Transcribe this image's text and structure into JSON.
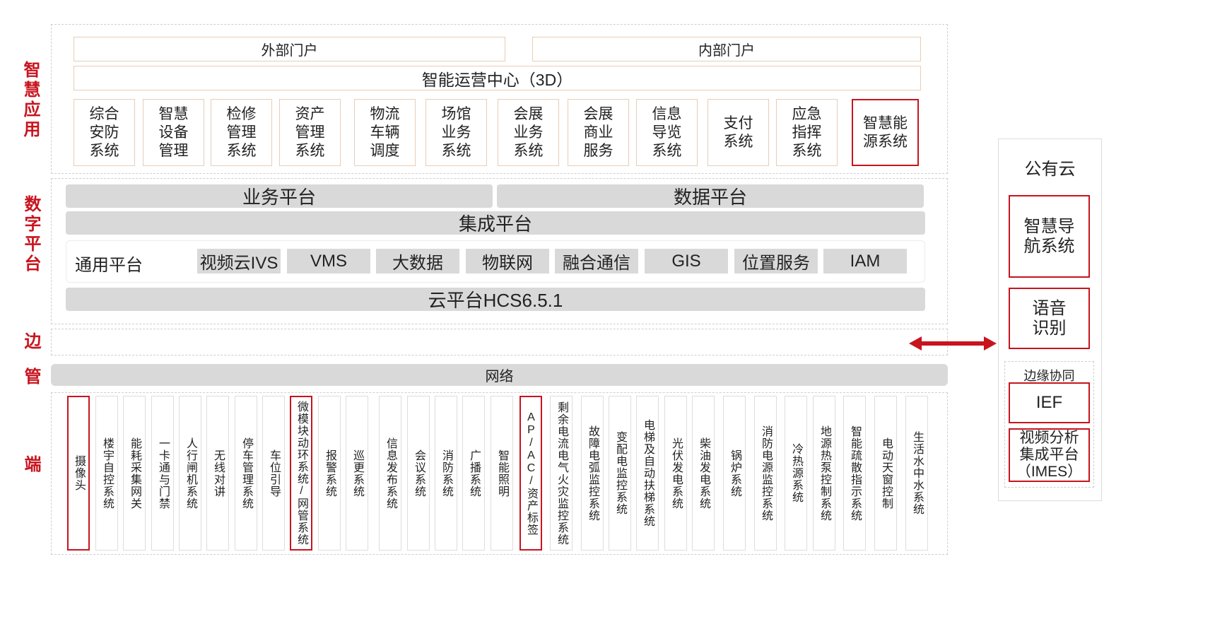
{
  "side_labels": {
    "app": "智慧应用",
    "platform": "数字平台",
    "edge": "边",
    "network": "管",
    "terminal": "端"
  },
  "portals": {
    "external": "外部门户",
    "internal": "内部门户",
    "ops_center": "智能运营中心（3D）"
  },
  "apps": [
    {
      "text": "综合安防系统",
      "highlight": false
    },
    {
      "text": "智慧设备管理",
      "highlight": false
    },
    {
      "text": "检修管理系统",
      "highlight": false
    },
    {
      "text": "资产管理系统",
      "highlight": false
    },
    {
      "text": "物流车辆调度",
      "highlight": false
    },
    {
      "text": "场馆业务系统",
      "highlight": false
    },
    {
      "text": "会展业务系统",
      "highlight": false
    },
    {
      "text": "会展商业服务",
      "highlight": false
    },
    {
      "text": "信息导览系统",
      "highlight": false
    },
    {
      "text": "支付系统",
      "highlight": false
    },
    {
      "text": "应急指挥系统",
      "highlight": false
    },
    {
      "text": "智慧能源系统",
      "highlight": true
    }
  ],
  "platform": {
    "business": "业务平台",
    "data": "数据平台",
    "integration": "集成平台",
    "general_label": "通用平台",
    "general_items": [
      "视频云IVS",
      "VMS",
      "大数据",
      "物联网",
      "融合通信",
      "GIS",
      "位置服务",
      "IAM"
    ],
    "cloud": "云平台HCS6.5.1"
  },
  "network": "网络",
  "devices": [
    {
      "text": "摄像头",
      "highlight": true
    },
    {
      "text": "楼宇自控系统",
      "highlight": false
    },
    {
      "text": "能耗采集网关",
      "highlight": false
    },
    {
      "text": "一卡通与门禁",
      "highlight": false
    },
    {
      "text": "人行闸机系统",
      "highlight": false
    },
    {
      "text": "无线对讲",
      "highlight": false
    },
    {
      "text": "停车管理系统",
      "highlight": false
    },
    {
      "text": "车位引导",
      "highlight": false
    },
    {
      "text": "微模块动环系统/网管系统",
      "highlight": true
    },
    {
      "text": "报警系统",
      "highlight": false
    },
    {
      "text": "巡更系统",
      "highlight": false
    },
    {
      "text": "信息发布系统",
      "highlight": false
    },
    {
      "text": "会议系统",
      "highlight": false
    },
    {
      "text": "消防系统",
      "highlight": false
    },
    {
      "text": "广播系统",
      "highlight": false
    },
    {
      "text": "智能照明",
      "highlight": false
    },
    {
      "text": "AP/AC/资产标签",
      "highlight": true
    },
    {
      "text": "剩余电流电气火灾监控系统",
      "highlight": false
    },
    {
      "text": "故障电弧监控系统",
      "highlight": false
    },
    {
      "text": "变配电监控系统",
      "highlight": false
    },
    {
      "text": "电梯及自动扶梯系统",
      "highlight": false
    },
    {
      "text": "光伏发电系统",
      "highlight": false
    },
    {
      "text": "柴油发电系统",
      "highlight": false
    },
    {
      "text": "锅炉系统",
      "highlight": false
    },
    {
      "text": "消防电源监控系统",
      "highlight": false
    },
    {
      "text": "冷热源系统",
      "highlight": false
    },
    {
      "text": "地源热泵控制系统",
      "highlight": false
    },
    {
      "text": "智能疏散指示系统",
      "highlight": false
    },
    {
      "text": "电动天窗控制",
      "highlight": false
    },
    {
      "text": "生活水中水系统",
      "highlight": false
    }
  ],
  "public_cloud": {
    "title": "公有云",
    "navigation": "智慧导\n航系统",
    "speech": "语音\n识别",
    "edge_group_title": "边缘协同",
    "ief": "IEF",
    "imes": "视频分析\n集成平台\n（IMES）"
  },
  "colors": {
    "accent": "#c8141e",
    "bar_gray": "#d9d9d9",
    "border_beige": "#e8cdb6"
  }
}
